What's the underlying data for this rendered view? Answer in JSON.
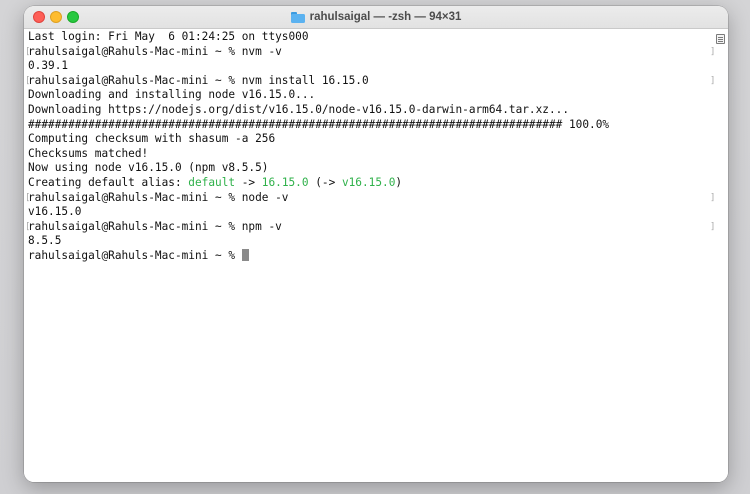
{
  "window": {
    "title": "rahulsaigal — -zsh — 94×31",
    "title_icon": "folder-icon"
  },
  "colors": {
    "close": "#fe5f57",
    "minimize": "#febc2e",
    "maximize": "#28c840",
    "highlight_green": "#2fb14a",
    "text": "#111111"
  },
  "terminal": {
    "lines": [
      "Last login: Fri May  6 01:24:25 on ttys000",
      "rahulsaigal@Rahuls-Mac-mini ~ % nvm -v",
      "0.39.1",
      "rahulsaigal@Rahuls-Mac-mini ~ % nvm install 16.15.0",
      "Downloading and installing node v16.15.0...",
      "Downloading https://nodejs.org/dist/v16.15.0/node-v16.15.0-darwin-arm64.tar.xz...",
      "################################################################################ 100.0%",
      "Computing checksum with shasum -a 256",
      "Checksums matched!",
      "Now using node v16.15.0 (npm v8.5.5)",
      "rahulsaigal@Rahuls-Mac-mini ~ % node -v",
      "v16.15.0",
      "rahulsaigal@Rahuls-Mac-mini ~ % npm -v",
      "8.5.5",
      "rahulsaigal@Rahuls-Mac-mini ~ % "
    ],
    "alias_line": {
      "prefix": "Creating default alias: ",
      "name": "default",
      "arrow1": " -> ",
      "version": "16.15.0",
      "paren_open": " (-> ",
      "resolved": "v16.15.0",
      "paren_close": ")"
    }
  }
}
